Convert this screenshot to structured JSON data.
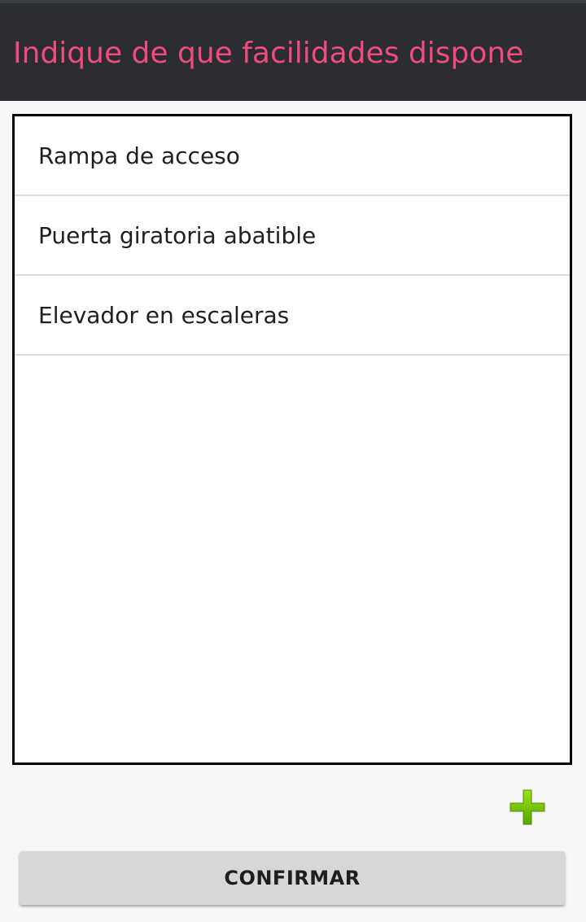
{
  "header": {
    "title": "Indique de que facilidades dispone",
    "title_color": "#ef4b7d",
    "background": "#2c2d32"
  },
  "facilities": {
    "items": [
      {
        "label": "Rampa de acceso"
      },
      {
        "label": "Puerta giratoria abatible"
      },
      {
        "label": "Elevador en escaleras"
      }
    ]
  },
  "actions": {
    "add_icon": "plus-icon",
    "add_icon_color": "#7cc400",
    "confirm_label": "CONFIRMAR"
  }
}
